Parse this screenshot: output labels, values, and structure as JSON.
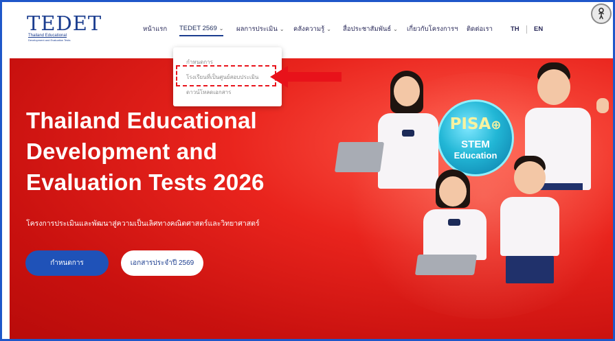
{
  "brand": {
    "logo_text": "TEDET",
    "tagline_line1": "Thailand Educational",
    "tagline_line2": "Development and Evaluation Tests"
  },
  "nav": {
    "items": [
      {
        "label": "หน้าแรก",
        "has_dropdown": false
      },
      {
        "label": "TEDET 2569",
        "has_dropdown": true,
        "active": true
      },
      {
        "label": "ผลการประเมิน",
        "has_dropdown": true
      },
      {
        "label": "คลังความรู้",
        "has_dropdown": true
      },
      {
        "label": "สื่อประชาสัมพันธ์",
        "has_dropdown": true
      },
      {
        "label": "เกี่ยวกับโครงการฯ",
        "has_dropdown": false
      },
      {
        "label": "ติดต่อเรา",
        "has_dropdown": false
      }
    ],
    "lang_th": "TH",
    "lang_en": "EN"
  },
  "dropdown": {
    "items": [
      {
        "label": "กำหนดการ"
      },
      {
        "label": "โรงเรียนที่เป็นศูนย์สอบประเมิน",
        "highlighted": true
      },
      {
        "label": "ดาวน์โหลดเอกสาร"
      }
    ]
  },
  "hero": {
    "title_line1": "Thailand Educational",
    "title_line2": "Development and",
    "title_line3": "Evaluation Tests 2026",
    "subtitle": "โครงการประเมินและพัฒนาสู่ความเป็นเลิศทางคณิตศาสตร์และวิทยาศาสตร์",
    "primary_button": "กำหนดการ",
    "secondary_button": "เอกสารประจำปี 2569",
    "badge_pisa": "PISA",
    "badge_stem": "STEM",
    "badge_education": "Education"
  },
  "icons": {
    "chevron": "chevron-down-icon",
    "accessibility": "accessibility-icon",
    "globe": "globe-icon"
  },
  "colors": {
    "brand_blue": "#1b3d8f",
    "primary_button": "#1f52b8",
    "hero_red": "#e9241d",
    "annotation_red": "#e8121a",
    "frame_border": "#1f57c9"
  }
}
